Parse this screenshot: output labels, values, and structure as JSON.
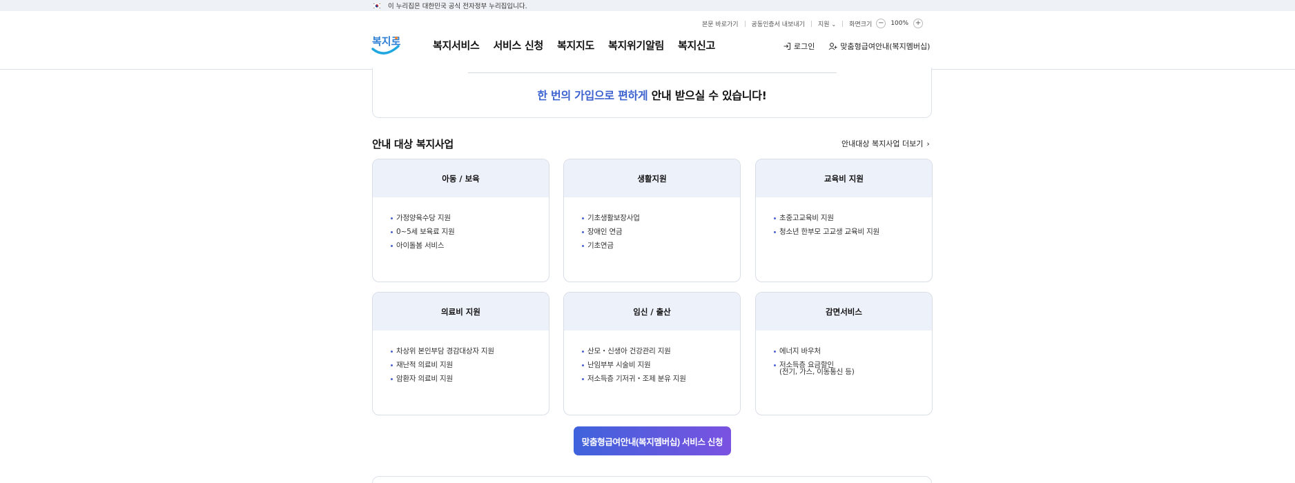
{
  "gov_banner": {
    "text": "이 누리집은 대한민국 공식 전자정부 누리집입니다."
  },
  "utility": {
    "skip_to_content": "본문 바로가기",
    "export_cert": "공동인증서 내보내기",
    "support": "지원",
    "zoom_label": "화면크기",
    "zoom_minus": "−",
    "zoom_value": "100%",
    "zoom_plus": "+"
  },
  "logo": {
    "text": "복지로"
  },
  "nav": {
    "items": [
      {
        "label": "복지서비스"
      },
      {
        "label": "서비스 신청"
      },
      {
        "label": "복지지도"
      },
      {
        "label": "복지위기알림"
      },
      {
        "label": "복지신고"
      }
    ]
  },
  "header_right": {
    "login": "로그인",
    "membership": "맞춤형급여안내(복지멤버십)"
  },
  "top_card": {
    "msg_blue": "한 번의 가입으로 편하게",
    "msg_dark": " 안내 받으실 수 있습니다!"
  },
  "section": {
    "title": "안내 대상 복지사업",
    "more": "안내대상 복지사업 더보기",
    "more_chevron": "›"
  },
  "cards": [
    {
      "title": "아동 / 보육",
      "items": [
        "가정양육수당 지원",
        "0~5세 보육료 지원",
        "아이돌봄 서비스"
      ]
    },
    {
      "title": "생활지원",
      "items": [
        "기초생활보장사업",
        "장애인 연금",
        "기초연금"
      ]
    },
    {
      "title": "교육비 지원",
      "items": [
        "초중고교육비 지원",
        "청소년 한부모 고교생 교육비 지원"
      ]
    },
    {
      "title": "의료비 지원",
      "items": [
        "차상위 본인부담 경감대상자 지원",
        "재난적 의료비 지원",
        "암환자 의료비 지원"
      ]
    },
    {
      "title": "임신 / 출산",
      "items": [
        "산모・신생아 건강관리 지원",
        "난임부부 시술비 지원",
        "저소득층 기저귀・조제 분유 지원"
      ]
    },
    {
      "title": "감면서비스",
      "items": [
        "에너지 바우처",
        "저소득층 요금할인",
        "(전기, 가스, 이동통신 등)"
      ]
    }
  ],
  "cta": {
    "label": "맞춤형급여안내(복지멤버십) 서비스 신청"
  },
  "colors": {
    "accent_blue": "#3b62cf",
    "card_head": "#edf1fa",
    "cta_start": "#3f63dc",
    "cta_end": "#7a52e0"
  }
}
